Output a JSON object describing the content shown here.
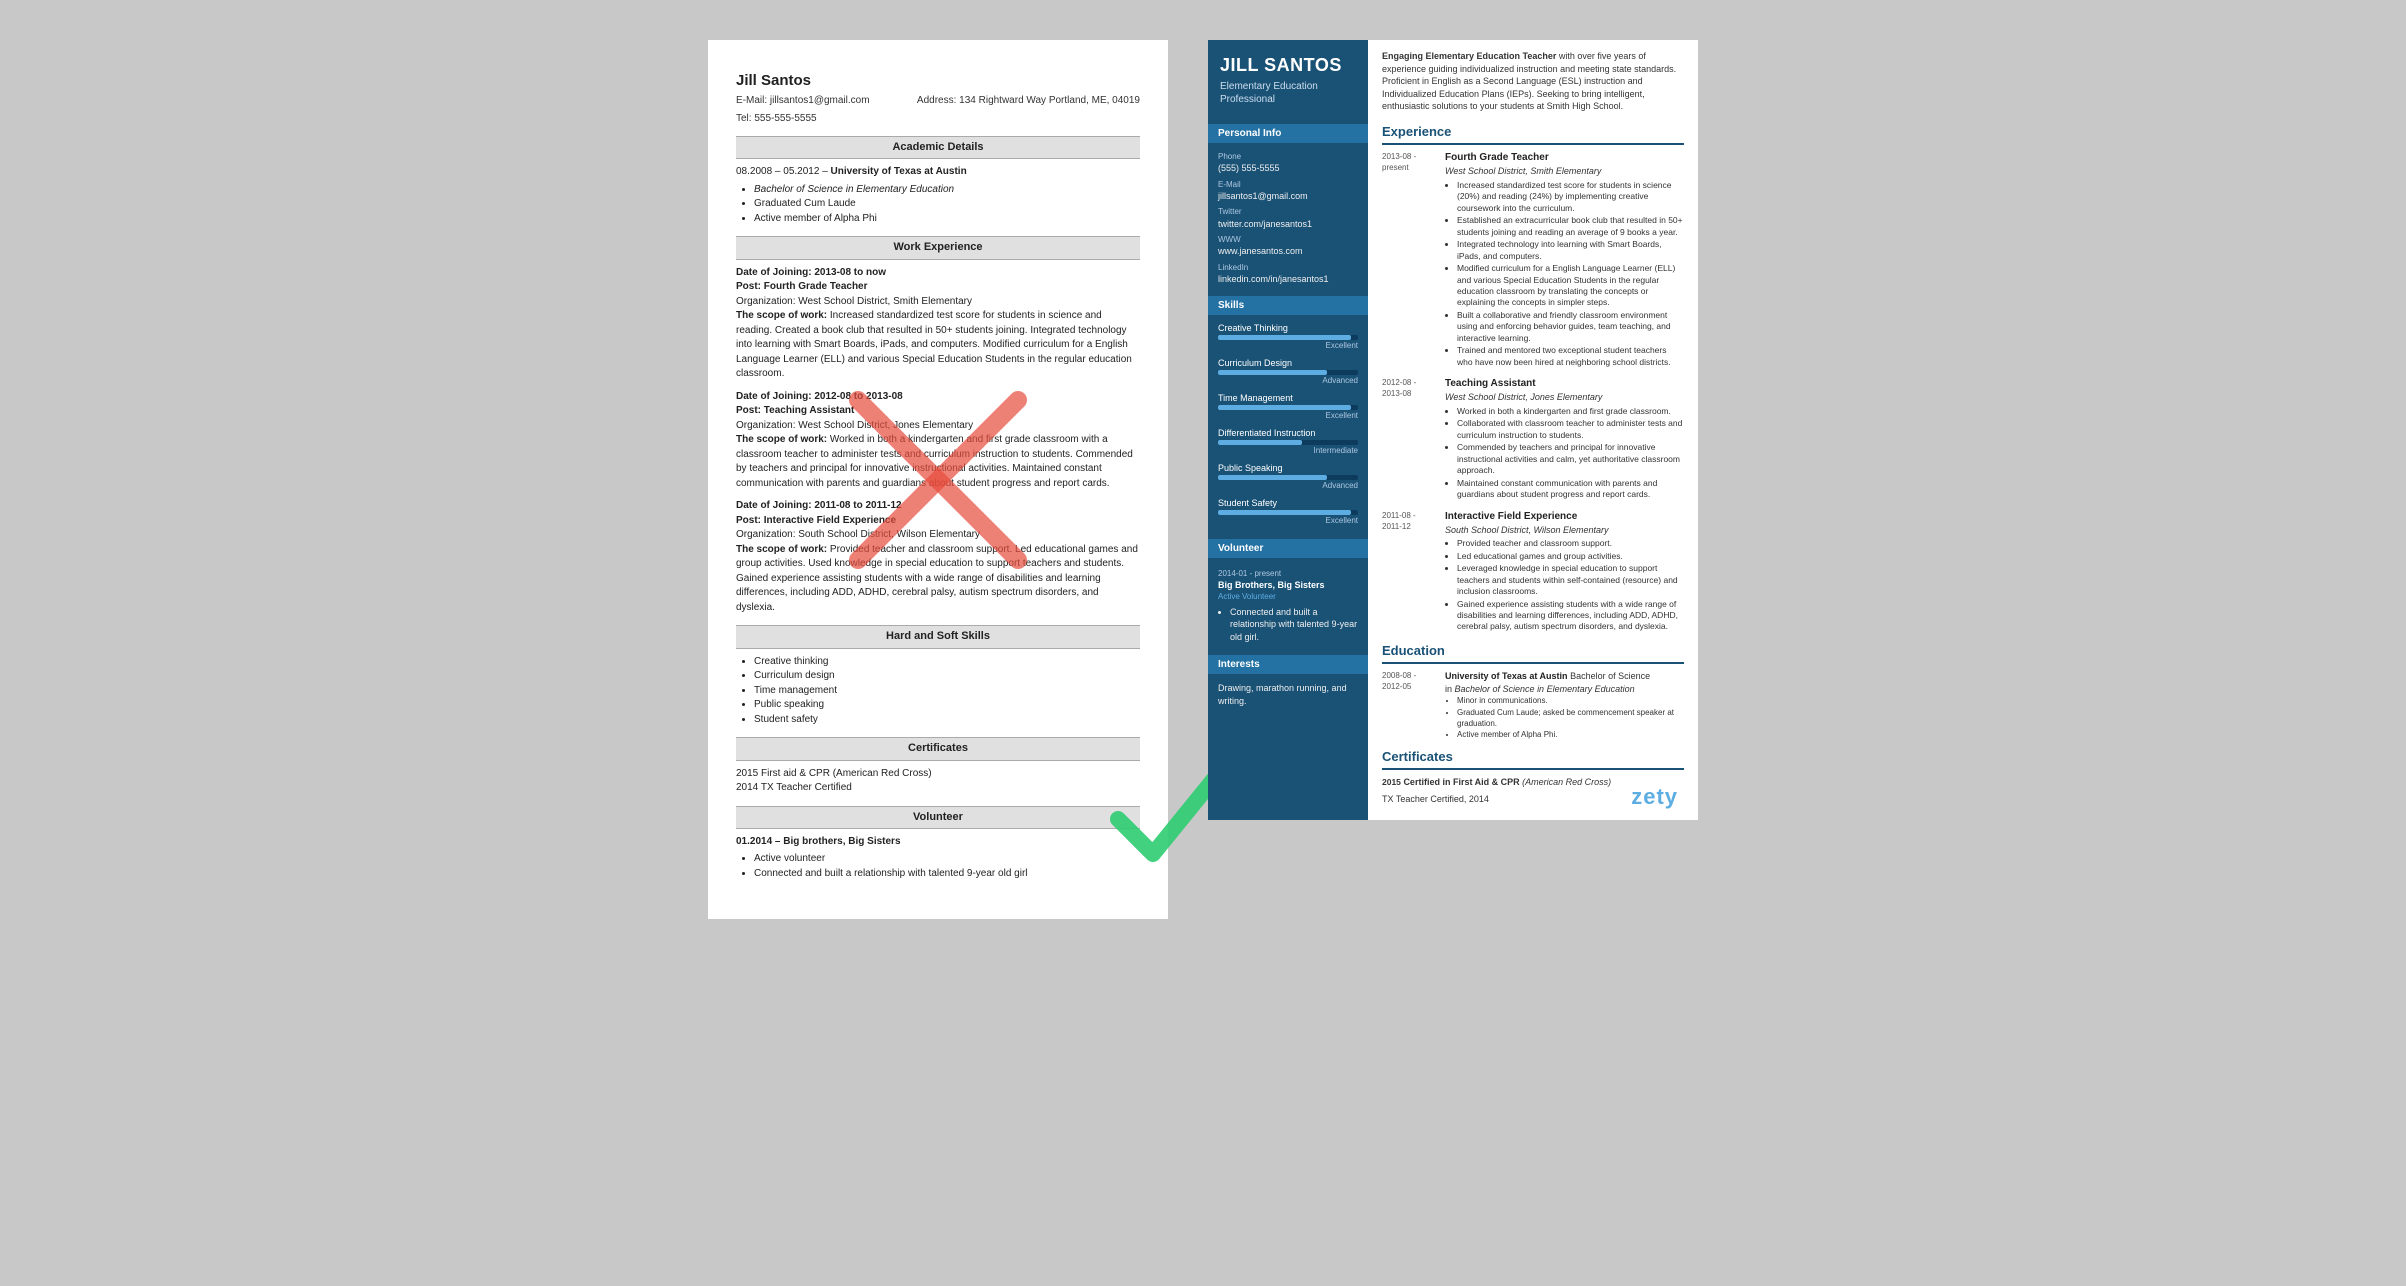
{
  "left_resume": {
    "name": "Jill Santos",
    "email_label": "E-Mail:",
    "email": "jillsantos1@gmail.com",
    "address_label": "Address:",
    "address": "134 Rightward Way Portland, ME, 04019",
    "tel_label": "Tel:",
    "tel": "555-555-5555",
    "sections": {
      "academic": "Academic Details",
      "work": "Work Experience",
      "skills": "Hard and Soft Skills",
      "certificates": "Certificates",
      "volunteer": "Volunteer"
    },
    "education": {
      "dates": "08.2008 – 05.2012",
      "school": "University of Texas at Austin",
      "degree": "Bachelor of Science in Elementary Education",
      "items": [
        "Graduated Cum Laude",
        "Active member of Alpha Phi"
      ]
    },
    "work_entries": [
      {
        "date": "Date of Joining: 2013-08 to now",
        "post": "Post: Fourth Grade Teacher",
        "org": "Organization: West School District, Smith Elementary",
        "scope_label": "The scope of work:",
        "scope": "Increased standardized test score for students in science and reading. Created a book club that resulted in 50+ students joining. Integrated technology into learning with Smart Boards, iPads, and computers. Modified curriculum for a English Language Learner (ELL) and various Special Education Students in the regular education classroom."
      },
      {
        "date": "Date of Joining: 2012-08 to 2013-08",
        "post": "Post: Teaching Assistant",
        "org": "Organization: West School District, Jones Elementary",
        "scope_label": "The scope of work:",
        "scope": "Worked in both a kindergarten and first grade classroom with a classroom teacher to administer tests and curriculum instruction to students. Commended by teachers and principal for innovative instructional activities. Maintained constant communication with parents and guardians about student progress and report cards."
      },
      {
        "date": "Date of Joining: 2011-08 to 2011-12",
        "post": "Post: Interactive Field Experience",
        "org": "Organization: South School District, Wilson Elementary",
        "scope_label": "The scope of work:",
        "scope": "Provided teacher and classroom support. Led educational games and group activities. Used knowledge in special education to support teachers and students. Gained experience assisting students with a wide range of disabilities and learning differences, including ADD, ADHD, cerebral palsy, autism spectrum disorders, and dyslexia."
      }
    ],
    "skills_list": [
      "Creative thinking",
      "Curriculum design",
      "Time management",
      "Public speaking",
      "Student safety"
    ],
    "certs": [
      "2015 First aid & CPR (American Red Cross)",
      "2014 TX Teacher Certified"
    ],
    "volunteer_entries": [
      {
        "date": "01.2014 – Big brothers, Big Sisters",
        "items": [
          "Active volunteer",
          "Connected and built a relationship with talented 9-year old girl"
        ]
      }
    ]
  },
  "right_resume": {
    "name": "JILL SANTOS",
    "title": "Elementary Education Professional",
    "summary": "Engaging Elementary Education Teacher with over five years of experience guiding individualized instruction and meeting state standards. Proficient in English as a Second Language (ESL) instruction and Individualized Education Plans (IEPs). Seeking to bring intelligent, enthusiastic solutions to your students at Smith High School.",
    "personal_info_title": "Personal Info",
    "personal_info": {
      "phone_label": "Phone",
      "phone": "(555) 555-5555",
      "email_label": "E-mail",
      "email": "jillsantos1@gmail.com",
      "twitter_label": "Twitter",
      "twitter": "twitter.com/janesantos1",
      "www_label": "WWW",
      "www": "www.janesantos.com",
      "linkedin_label": "LinkedIn",
      "linkedin": "linkedin.com/in/janesantos1"
    },
    "skills_title": "Skills",
    "skills": [
      {
        "name": "Creative Thinking",
        "level": "Excellent",
        "pct": 95
      },
      {
        "name": "Curriculum Design",
        "level": "Advanced",
        "pct": 78
      },
      {
        "name": "Time Management",
        "level": "Excellent",
        "pct": 95
      },
      {
        "name": "Differentiated Instruction",
        "level": "Intermediate",
        "pct": 60
      },
      {
        "name": "Public Speaking",
        "level": "Advanced",
        "pct": 78
      },
      {
        "name": "Student Safety",
        "level": "Excellent",
        "pct": 95
      }
    ],
    "volunteer_title": "Volunteer",
    "volunteer": {
      "dates": "2014-01 - present",
      "org": "Big Brothers, Big Sisters",
      "role": "Active Volunteer",
      "bullets": [
        "Connected and built a relationship with talented 9-year old girl."
      ]
    },
    "interests_title": "Interests",
    "interests": "Drawing, marathon running, and writing.",
    "experience_title": "Experience",
    "experience": [
      {
        "dates": "2013-08 -\npresent",
        "title": "Fourth Grade Teacher",
        "org": "West School District, Smith Elementary",
        "bullets": [
          "Increased standardized test score for students in science (20%) and reading (24%) by implementing creative coursework into the curriculum.",
          "Established an extracurricular book club that resulted in 50+ students joining and reading an average of 9 books a year.",
          "Integrated technology into learning with Smart Boards, iPads, and computers.",
          "Modified curriculum for a English Language Learner (ELL) and various Special Education Students in the regular education classroom by translating the concepts or explaining the concepts in simpler steps.",
          "Built a collaborative and friendly classroom environment using and enforcing behavior guides, team teaching, and interactive learning.",
          "Trained and mentored two exceptional student teachers who have now been hired at neighboring school districts."
        ]
      },
      {
        "dates": "2012-08 -\n2013-08",
        "title": "Teaching Assistant",
        "org": "West School District, Jones Elementary",
        "bullets": [
          "Worked in both a kindergarten and first grade classroom.",
          "Collaborated with classroom teacher to administer tests and curriculum instruction to students.",
          "Commended by teachers and principal for innovative instructional activities and calm, yet authoritative classroom approach.",
          "Maintained constant communication with parents and guardians about student progress and report cards."
        ]
      },
      {
        "dates": "2011-08 -\n2011-12",
        "title": "Interactive Field Experience",
        "org": "South School District, Wilson Elementary",
        "bullets": [
          "Provided teacher and classroom support.",
          "Led educational games and group activities.",
          "Leveraged knowledge in special education to support teachers and students within self-contained (resource) and inclusion classrooms.",
          "Gained experience assisting students with a wide range of disabilities and learning differences, including ADD, ADHD, cerebral palsy, autism spectrum disorders, and dyslexia."
        ]
      }
    ],
    "education_title": "Education",
    "education": [
      {
        "dates": "2008-08 -\n2012-05",
        "school": "University of Texas at Austin",
        "degree": "Bachelor of Science in Elementary Education",
        "bullets": [
          "Minor in communications.",
          "Graduated Cum Laude; asked be commencement speaker at graduation.",
          "Active member of Alpha Phi."
        ]
      }
    ],
    "certs_title": "Certificates",
    "certs": [
      {
        "year": "2015",
        "text": "Certified in First Aid & CPR (American Red Cross)"
      },
      {
        "year": "",
        "text": "TX Teacher Certified, 2014"
      }
    ]
  },
  "watermark": "zety"
}
